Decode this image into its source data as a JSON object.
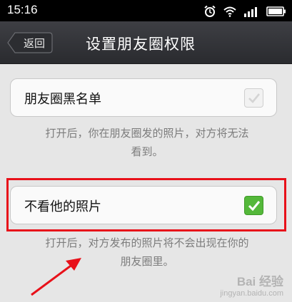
{
  "status_bar": {
    "time": "15:16",
    "icons": [
      "alarm-icon",
      "wifi-icon",
      "signal-icon",
      "battery-icon"
    ]
  },
  "header": {
    "back_label": "返回",
    "title": "设置朋友圈权限"
  },
  "settings": [
    {
      "label": "朋友圈黑名单",
      "checked": false,
      "description_lines": [
        "打开后，你在朋友圈发的照片，对方将无法",
        "看到。"
      ]
    },
    {
      "label": "不看他的照片",
      "checked": true,
      "description_lines": [
        "打开后，对方发布的照片将不会出现在你的",
        "朋友圈里。"
      ]
    }
  ],
  "watermark": {
    "brand": "Bai 经验",
    "url": "jingyan.baidu.com"
  },
  "colors": {
    "highlight": "#e8111a",
    "check_on": "#54b83a",
    "titlebar": "#2a2b2f"
  }
}
